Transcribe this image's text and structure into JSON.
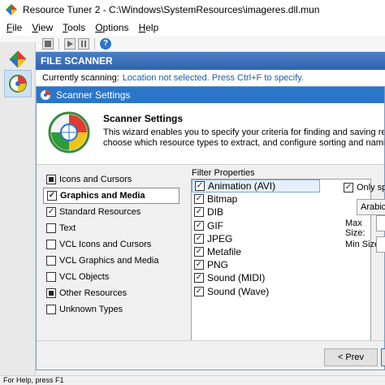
{
  "window": {
    "title": "Resource Tuner 2 - C:\\Windows\\SystemResources\\imageres.dll.mun"
  },
  "menu": [
    {
      "underline": "F",
      "rest": "ile"
    },
    {
      "underline": "V",
      "rest": "iew"
    },
    {
      "underline": "T",
      "rest": "ools"
    },
    {
      "underline": "O",
      "rest": "ptions"
    },
    {
      "underline": "H",
      "rest": "elp"
    }
  ],
  "toolbar": {
    "icons": [
      "stop-icon",
      "play-icon",
      "pause-icon",
      "help-icon"
    ]
  },
  "scanner": {
    "header": "FILE SCANNER",
    "scanning_label": "Currently scanning:",
    "scanning_value": "Location not selected. Press Ctrl+F to specify."
  },
  "dialog": {
    "title": "Scanner Settings",
    "heading": "Scanner Settings",
    "desc_line1": "This wizard enables you to specify your criteria for finding and saving resources from fil",
    "desc_line2": "choose which resource types to extract, and configure sorting and naming options for e",
    "types": [
      {
        "label": "Icons and Cursors",
        "state": "partial",
        "selected": false
      },
      {
        "label": "Graphics and Media",
        "state": "checked",
        "selected": true
      },
      {
        "label": "Standard Resources",
        "state": "checked",
        "selected": false
      },
      {
        "label": "Text",
        "state": "unchecked",
        "selected": false
      },
      {
        "label": "VCL Icons and Cursors",
        "state": "unchecked",
        "selected": false
      },
      {
        "label": "VCL Graphics and Media",
        "state": "unchecked",
        "selected": false
      },
      {
        "label": "VCL Objects",
        "state": "unchecked",
        "selected": false
      },
      {
        "label": "Other Resources",
        "state": "partial",
        "selected": false
      },
      {
        "label": "Unknown Types",
        "state": "unchecked",
        "selected": false
      }
    ],
    "filter_label": "Filter Properties",
    "filters": [
      {
        "label": "Animation (AVI)",
        "checked": true,
        "selected": true
      },
      {
        "label": "Bitmap",
        "checked": true,
        "selected": false
      },
      {
        "label": "DIB",
        "checked": true,
        "selected": false
      },
      {
        "label": "GIF",
        "checked": true,
        "selected": false
      },
      {
        "label": "JPEG",
        "checked": true,
        "selected": false
      },
      {
        "label": "Metafile",
        "checked": true,
        "selected": false
      },
      {
        "label": "PNG",
        "checked": true,
        "selected": false
      },
      {
        "label": "Sound (MIDI)",
        "checked": true,
        "selected": false
      },
      {
        "label": "Sound (Wave)",
        "checked": true,
        "selected": false
      }
    ],
    "only_label": "Only spe",
    "language_value": "Arabic (S",
    "max_size_label": "Max Size:",
    "min_size_label": "Min Size:",
    "prev_button": "< Prev"
  },
  "statusbar": {
    "text": "For Help, press F1"
  },
  "colors": {
    "header_blue": "#2f63ad",
    "dialog_title_blue": "#2a76c8",
    "link_blue": "#1f5ca8"
  }
}
